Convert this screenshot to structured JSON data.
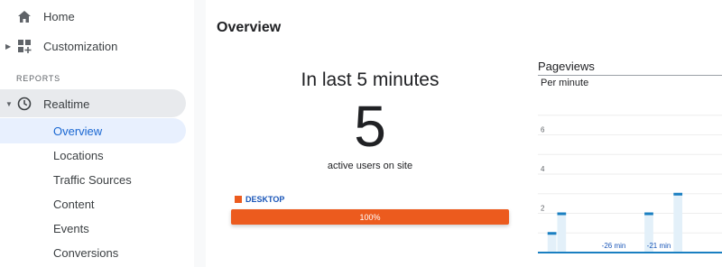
{
  "sidebar": {
    "home": "Home",
    "customization": "Customization",
    "section_label": "REPORTS",
    "realtime": "Realtime",
    "items": [
      "Overview",
      "Locations",
      "Traffic Sources",
      "Content",
      "Events",
      "Conversions"
    ]
  },
  "main": {
    "title": "Overview",
    "realtime_heading": "In last 5 minutes",
    "active_users": "5",
    "active_users_caption": "active users on site",
    "device_legend": "DESKTOP",
    "device_percent": "100%",
    "device_fraction": 1.0,
    "colors": {
      "desktop": "#ec5b1e",
      "accent": "#1967d2",
      "chart_bar": "#1a7fc1"
    }
  },
  "chart_data": {
    "type": "bar",
    "title": "Pageviews",
    "subtitle": "Per minute",
    "y_ticks": [
      "6",
      "4",
      "2"
    ],
    "x_labels": [
      "-26 min",
      "-21 min"
    ],
    "ylim": [
      0,
      8
    ],
    "values": [
      0,
      1,
      2,
      0,
      0,
      0,
      0,
      0,
      0,
      0,
      0,
      2,
      0,
      0,
      3,
      0,
      0,
      0,
      0
    ]
  }
}
